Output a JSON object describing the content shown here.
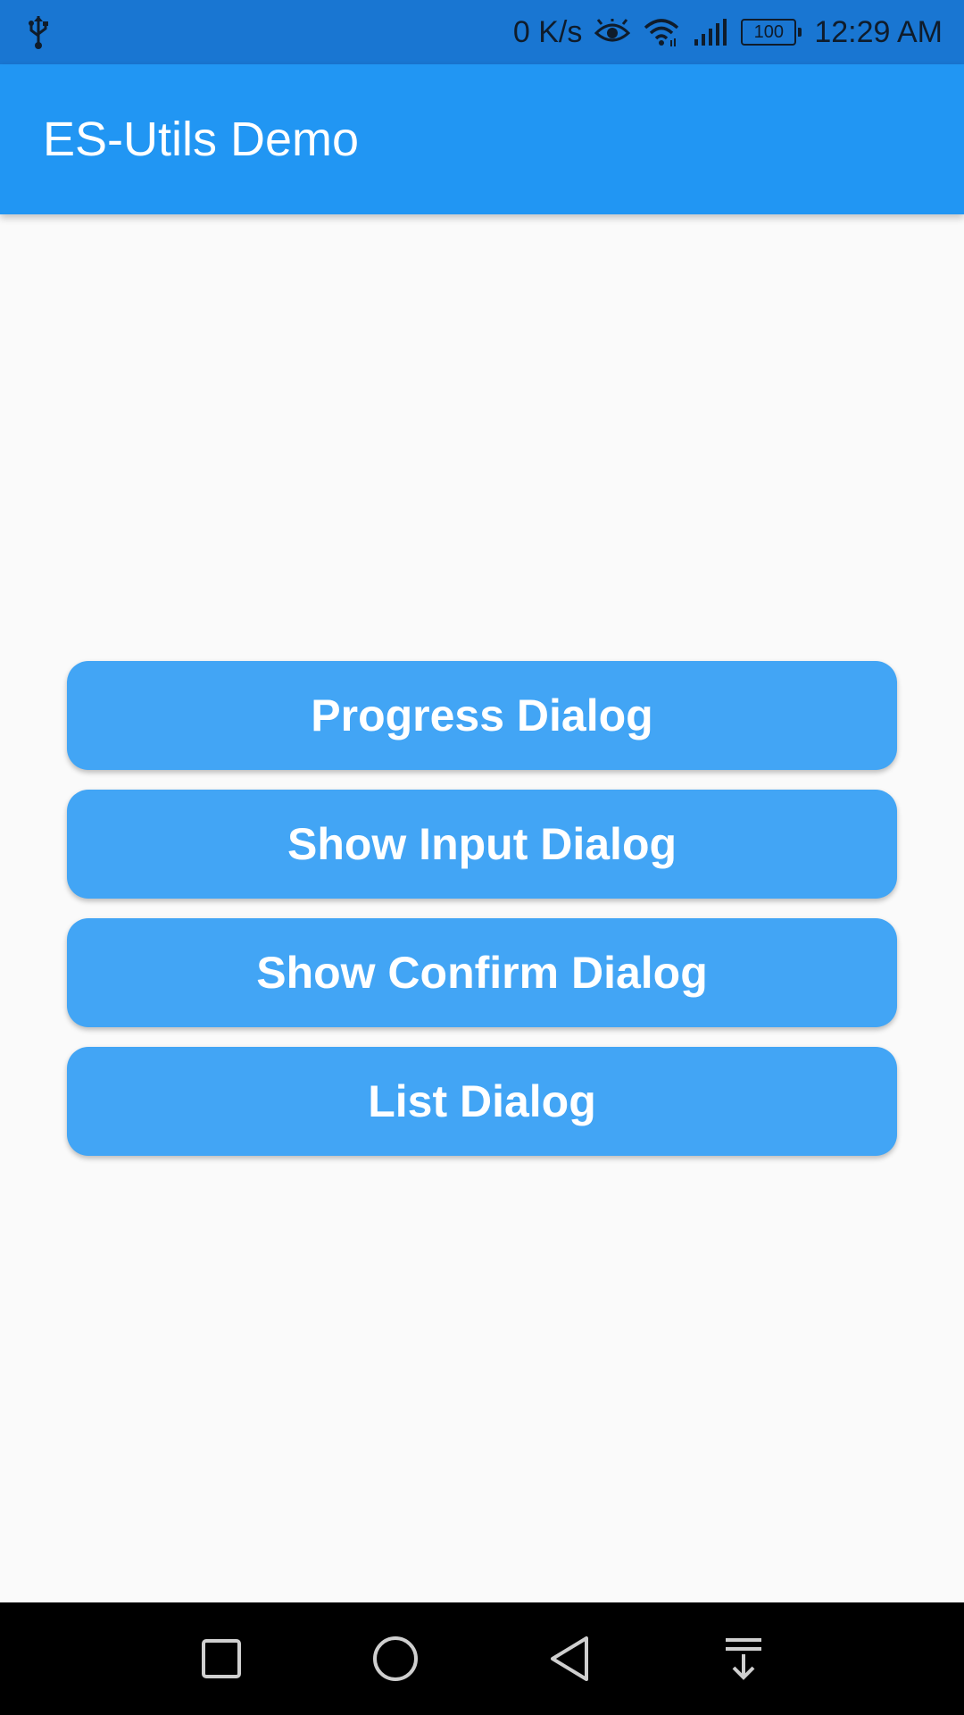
{
  "status_bar": {
    "left_icon": "usb-icon",
    "net_speed": "0 K/s",
    "icons": [
      "eye-icon",
      "wifi-icon",
      "signal-icon"
    ],
    "battery": "100",
    "time": "12:29 AM"
  },
  "app_bar": {
    "title": "ES-Utils Demo",
    "color": "#2196f3"
  },
  "buttons": [
    {
      "label": "Progress Dialog"
    },
    {
      "label": "Show Input Dialog"
    },
    {
      "label": "Show Confirm Dialog"
    },
    {
      "label": "List Dialog"
    }
  ],
  "button_color": "#42a5f5",
  "nav_bar": {
    "icons": [
      "recents-square-icon",
      "home-circle-icon",
      "back-triangle-icon",
      "notification-pulldown-icon"
    ]
  }
}
